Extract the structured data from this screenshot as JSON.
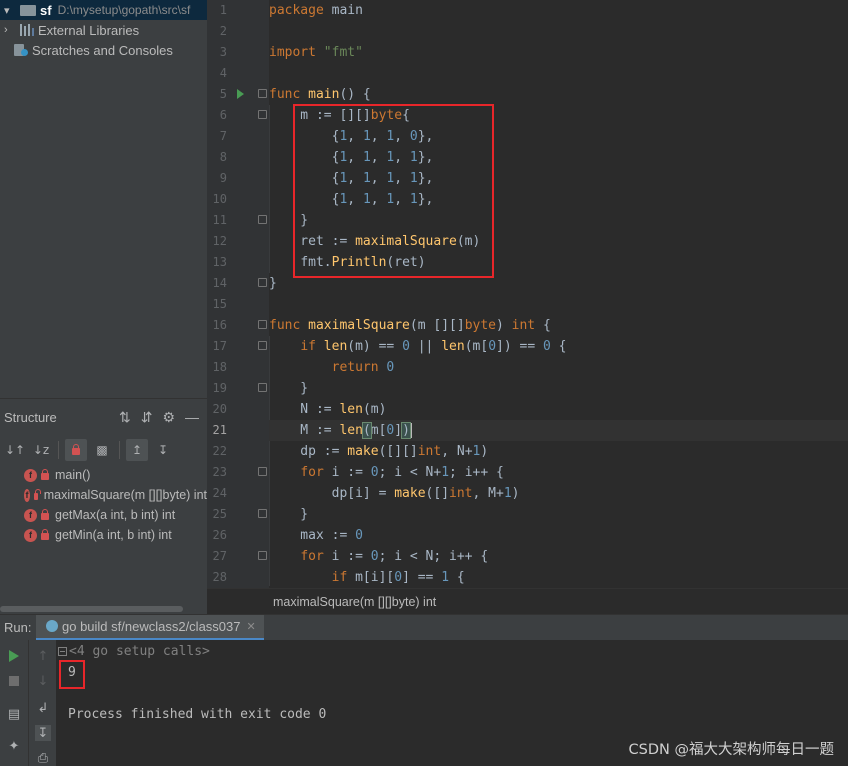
{
  "project_tree": {
    "root_name": "sf",
    "root_path": "D:\\mysetup\\gopath\\src\\sf",
    "external_libraries": "External Libraries",
    "scratches": "Scratches and Consoles"
  },
  "structure": {
    "title": "Structure",
    "items": [
      {
        "label": "main()"
      },
      {
        "label": "maximalSquare(m [][]byte) int"
      },
      {
        "label": "getMax(a int, b int) int"
      },
      {
        "label": "getMin(a int, b int) int"
      }
    ]
  },
  "editor": {
    "line_numbers": [
      "1",
      "2",
      "3",
      "4",
      "5",
      "6",
      "7",
      "8",
      "9",
      "10",
      "11",
      "12",
      "13",
      "14",
      "15",
      "16",
      "17",
      "18",
      "19",
      "20",
      "21",
      "22",
      "23",
      "24",
      "25",
      "26",
      "27",
      "28"
    ],
    "current_line": "21",
    "breadcrumb": "maximalSquare(m [][]byte) int"
  },
  "run": {
    "label": "Run:",
    "tab_title": "go build sf/newclass2/class037",
    "folded_line": "<4 go setup calls>",
    "output": "9",
    "exit_message": "Process finished with exit code 0"
  },
  "watermark": "CSDN @福大大架构师每日一题"
}
